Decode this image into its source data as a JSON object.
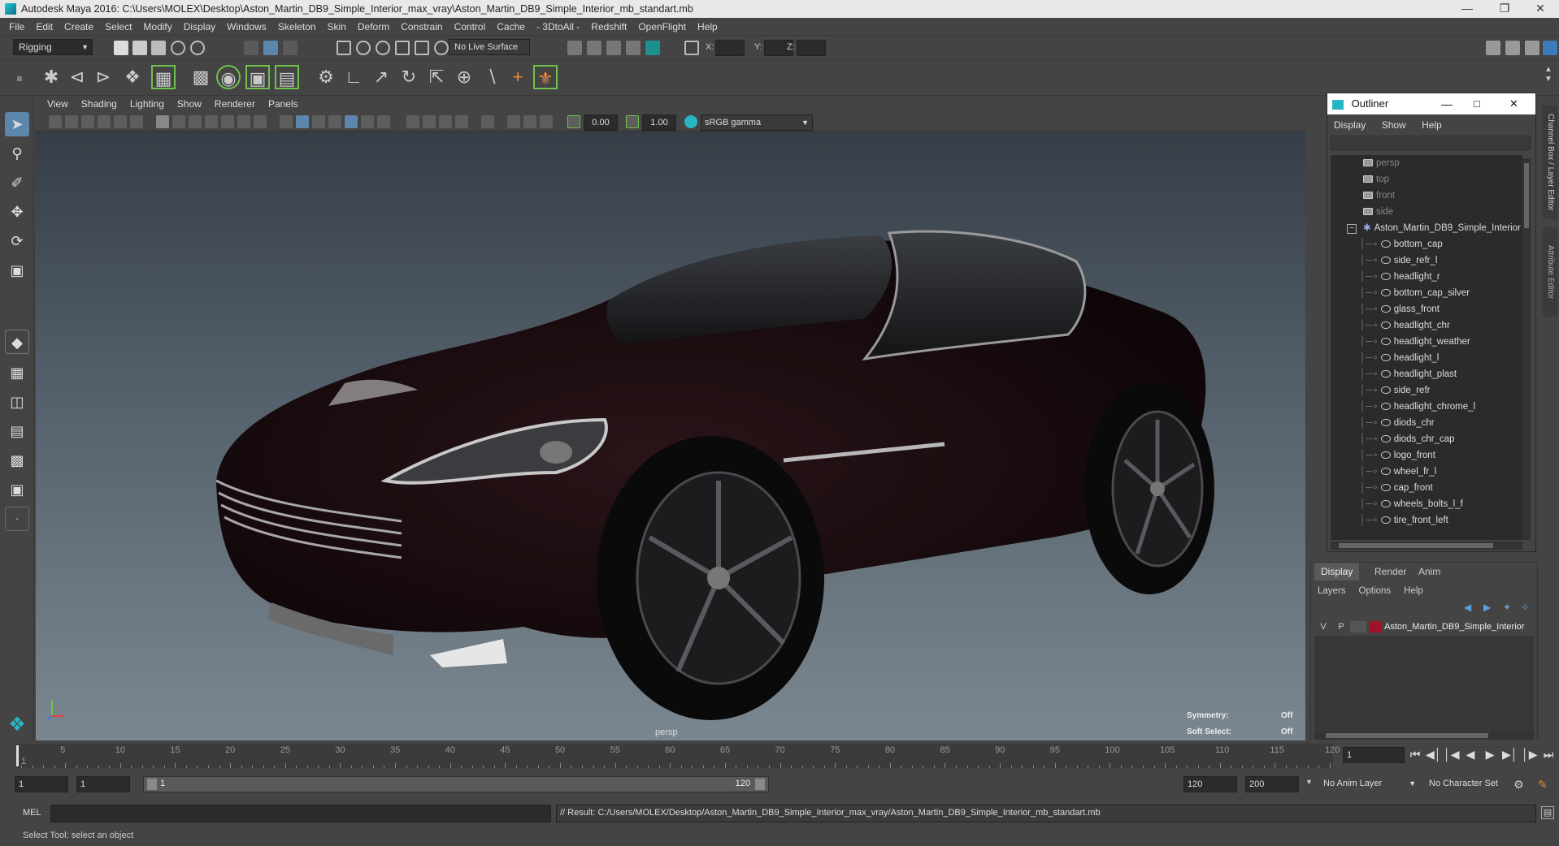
{
  "window": {
    "title": "Autodesk Maya 2016: C:\\Users\\MOLEX\\Desktop\\Aston_Martin_DB9_Simple_Interior_max_vray\\Aston_Martin_DB9_Simple_Interior_mb_standart.mb"
  },
  "menubar": {
    "items": [
      "File",
      "Edit",
      "Create",
      "Select",
      "Modify",
      "Display",
      "Windows",
      "Skeleton",
      "Skin",
      "Deform",
      "Constrain",
      "Control",
      "Cache",
      "- 3DtoAll -",
      "Redshift",
      "OpenFlight",
      "Help"
    ]
  },
  "statusline": {
    "mode": "Rigging",
    "live_surface": "No Live Surface",
    "x_label": "X:",
    "y_label": "Y:",
    "z_label": "Z:"
  },
  "viewport": {
    "menu": [
      "View",
      "Shading",
      "Lighting",
      "Show",
      "Renderer",
      "Panels"
    ],
    "exposure": "0.00",
    "gamma": "1.00",
    "color_space": "sRGB gamma",
    "camera_label": "persp",
    "symmetry_label": "Symmetry:",
    "symmetry_value": "Off",
    "soft_select_label": "Soft Select:",
    "soft_select_value": "Off"
  },
  "outliner": {
    "title": "Outliner",
    "menu": [
      "Display",
      "Show",
      "Help"
    ],
    "cameras": [
      "persp",
      "top",
      "front",
      "side"
    ],
    "group": "Aston_Martin_DB9_Simple_Interior",
    "children": [
      "bottom_cap",
      "side_refr_l",
      "headlight_r",
      "bottom_cap_silver",
      "glass_front",
      "headlight_chr",
      "headlight_weather",
      "headlight_l",
      "headlight_plast",
      "side_refr",
      "headlight_chrome_l",
      "diods_chr",
      "diods_chr_cap",
      "logo_front",
      "wheel_fr_l",
      "cap_front",
      "wheels_bolts_l_f",
      "tire_front_left"
    ]
  },
  "side_tabs": [
    "Channel Box / Layer Editor",
    "Attribute Editor"
  ],
  "layer_editor": {
    "tabs": [
      "Display",
      "Render",
      "Anim"
    ],
    "active_tab": "Display",
    "menu": [
      "Layers",
      "Options",
      "Help"
    ],
    "layer": {
      "v": "V",
      "p": "P",
      "name": "Aston_Martin_DB9_Simple_Interior",
      "color": "#a3102e"
    }
  },
  "timeline": {
    "ticks": [
      "5",
      "10",
      "15",
      "20",
      "25",
      "30",
      "35",
      "40",
      "45",
      "50",
      "55",
      "60",
      "65",
      "70",
      "75",
      "80",
      "85",
      "90",
      "95",
      "100",
      "105",
      "110",
      "115",
      "120"
    ],
    "first_tick": "1",
    "current_frame": "1"
  },
  "range": {
    "start": "1",
    "start_inner": "1",
    "slider_start": "1",
    "slider_end": "120",
    "end_inner": "120",
    "end": "200",
    "anim_layer": "No Anim Layer",
    "character_set": "No Character Set"
  },
  "mel": {
    "label": "MEL",
    "result": "// Result: C:/Users/MOLEX/Desktop/Aston_Martin_DB9_Simple_Interior_max_vray/Aston_Martin_DB9_Simple_Interior_mb_standart.mb"
  },
  "help_line": "Select Tool: select an object",
  "colors": {
    "accent_teal": "#27b5c4",
    "car_body": "#1a0c0f",
    "active_tool": "#5d86ac"
  }
}
